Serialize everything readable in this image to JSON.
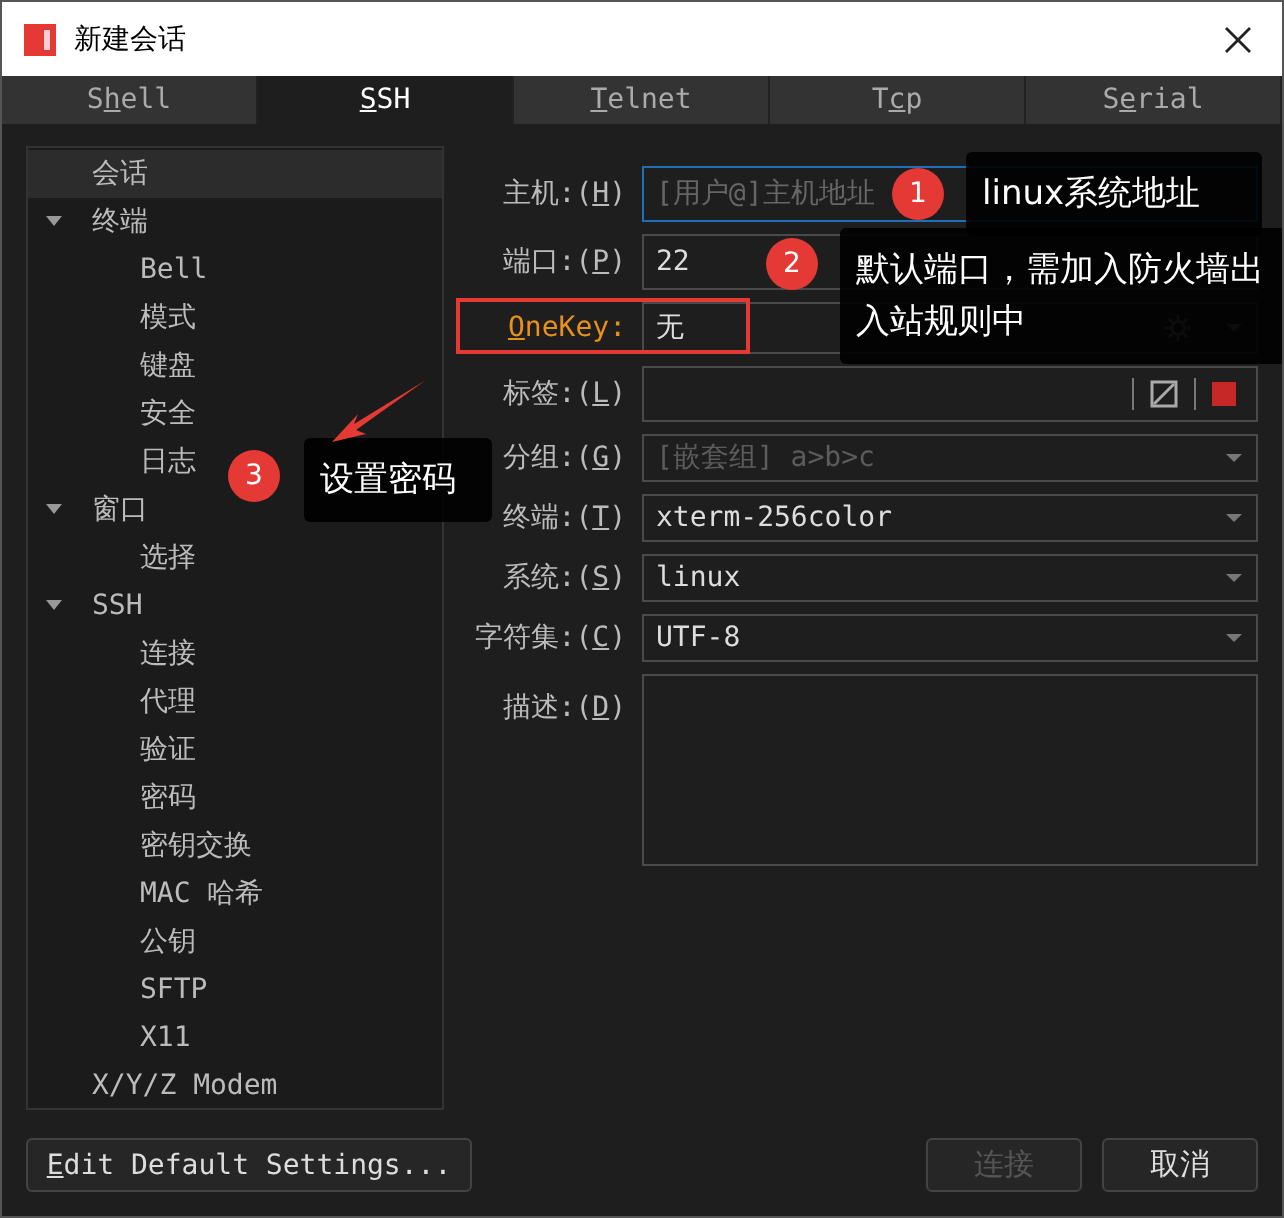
{
  "window": {
    "title": "新建会话"
  },
  "tabs": [
    {
      "pre": "S",
      "key": "h",
      "post": "ell",
      "selected": false
    },
    {
      "key": "S",
      "post": "SH",
      "selected": true
    },
    {
      "key": "T",
      "post": "elnet",
      "selected": false
    },
    {
      "pre": "T",
      "key": "c",
      "post": "p",
      "selected": false
    },
    {
      "pre": "S",
      "key": "e",
      "post": "rial",
      "selected": false
    }
  ],
  "sidebar": {
    "items": [
      {
        "label": "会话",
        "selected": true
      },
      {
        "label": "终端",
        "selected": false,
        "expanded": true,
        "children": [
          {
            "label": "Bell",
            "selected": false
          },
          {
            "label": "模式",
            "selected": false
          },
          {
            "label": "键盘",
            "selected": false
          },
          {
            "label": "安全",
            "selected": false
          },
          {
            "label": "日志",
            "selected": false
          }
        ]
      },
      {
        "label": "窗口",
        "selected": false,
        "expanded": true,
        "children": [
          {
            "label": "选择",
            "selected": false
          }
        ]
      },
      {
        "label": "SSH",
        "selected": false,
        "expanded": true,
        "children": [
          {
            "label": "连接",
            "selected": false
          },
          {
            "label": "代理",
            "selected": false
          },
          {
            "label": "验证",
            "selected": false
          },
          {
            "label": "密码",
            "selected": false
          },
          {
            "label": "密钥交换",
            "selected": false
          },
          {
            "label": "MAC 哈希",
            "selected": false
          },
          {
            "label": "公钥",
            "selected": false
          },
          {
            "label": "SFTP",
            "selected": false
          },
          {
            "label": "X11",
            "selected": false
          }
        ]
      },
      {
        "label": "X/Y/Z Modem",
        "selected": false
      }
    ]
  },
  "fields": [
    {
      "kind": "text",
      "pre": "主机:(",
      "key": "H",
      "post": ")",
      "placeholder": "[用户@]主机地址",
      "focused": true,
      "highlighted": false
    },
    {
      "kind": "text",
      "pre": "端口:(",
      "key": "P",
      "post": ")",
      "value": "22",
      "focused": false,
      "highlighted": false
    },
    {
      "kind": "onekey",
      "key": "O",
      "post": "neKey:",
      "value": "无",
      "focused": false,
      "highlighted": true
    },
    {
      "kind": "tag",
      "pre": "标签:(",
      "key": "L",
      "post": ")",
      "focused": false,
      "highlighted": false
    },
    {
      "kind": "combo",
      "pre": "分组:(",
      "key": "G",
      "post": ")",
      "placeholder": "[嵌套组] a>b>c",
      "focused": false,
      "highlighted": false
    },
    {
      "kind": "combo",
      "pre": "终端:(",
      "key": "T",
      "post": ")",
      "value": "xterm-256color",
      "focused": false,
      "highlighted": false
    },
    {
      "kind": "combo",
      "pre": "系统:(",
      "key": "S",
      "post": ")",
      "value": "linux",
      "focused": false,
      "highlighted": false
    },
    {
      "kind": "combo",
      "pre": "字符集:(",
      "key": "C",
      "post": ")",
      "value": "UTF-8",
      "focused": false,
      "highlighted": false
    },
    {
      "kind": "textarea",
      "pre": "描述:(",
      "key": "D",
      "post": ")",
      "focused": false,
      "highlighted": false
    }
  ],
  "annotations": [
    {
      "number": "1",
      "text": "linux系统地址"
    },
    {
      "number": "2",
      "text": "默认端口，需加入防火墙出入站规则中"
    },
    {
      "number": "3",
      "text": "设置密码"
    }
  ],
  "buttons": {
    "edit_defaults": {
      "key": "E",
      "post": "dit Default Settings..."
    },
    "actions": [
      {
        "label": "连接",
        "disabled": true
      },
      {
        "label": "取消",
        "disabled": false
      }
    ]
  }
}
